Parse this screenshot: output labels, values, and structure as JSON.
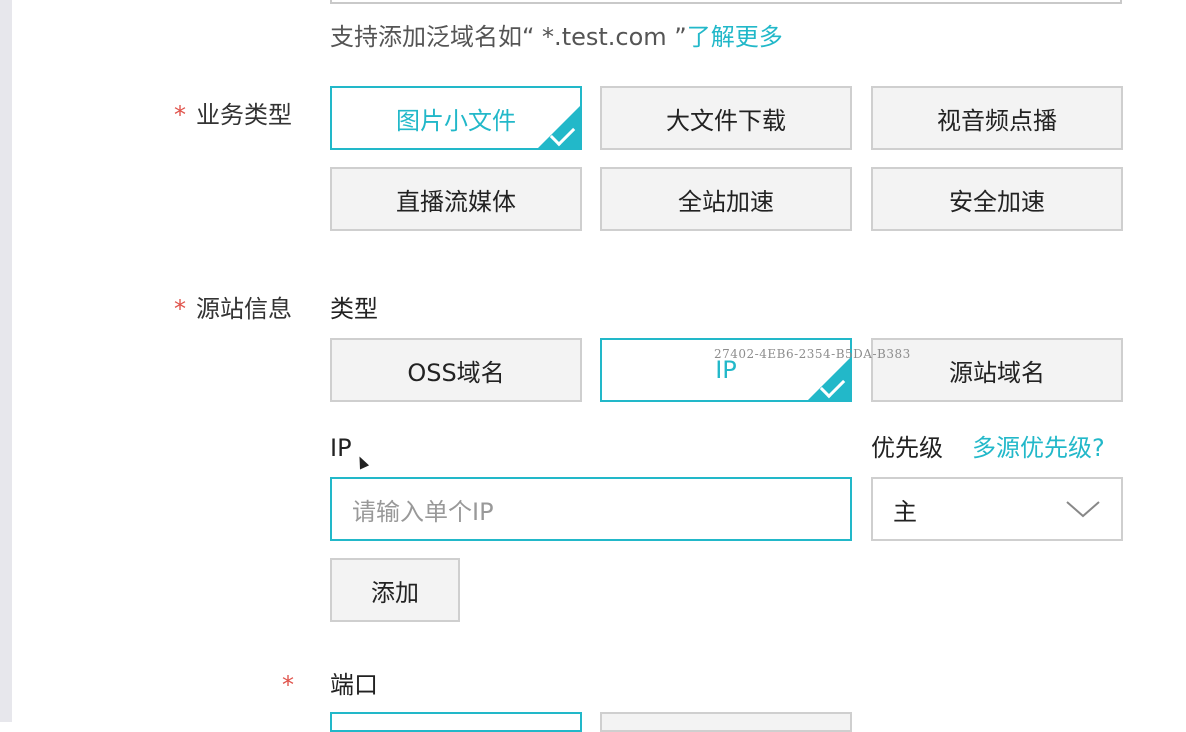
{
  "domain_hint": {
    "text_prefix": "支持添加泛域名如“ *.test.com ”",
    "link": "了解更多"
  },
  "business_type": {
    "label": "业务类型",
    "required_mark": "*",
    "options": [
      {
        "label": "图片小文件",
        "selected": true
      },
      {
        "label": "大文件下载",
        "selected": false
      },
      {
        "label": "视音频点播",
        "selected": false
      },
      {
        "label": "直播流媒体",
        "selected": false
      },
      {
        "label": "全站加速",
        "selected": false
      },
      {
        "label": "安全加速",
        "selected": false
      }
    ]
  },
  "origin_info": {
    "label": "源站信息",
    "required_mark": "*",
    "type_label": "类型",
    "type_options": [
      {
        "label": "OSS域名",
        "selected": false
      },
      {
        "label": "IP",
        "selected": true
      },
      {
        "label": "源站域名",
        "selected": false
      }
    ],
    "ip_label": "IP",
    "ip_input_placeholder": "请输入单个IP",
    "priority_label": "优先级",
    "priority_link": "多源优先级?",
    "priority_value": "主",
    "add_button": "添加",
    "watermark": "27402-4EB6-2354-B5DA-B383"
  },
  "port": {
    "label": "端口",
    "required_mark": "*"
  },
  "colors": {
    "accent": "#22b8c9",
    "required": "#e0534b",
    "option_bg": "#f3f3f3",
    "border": "#cfcfcf"
  }
}
